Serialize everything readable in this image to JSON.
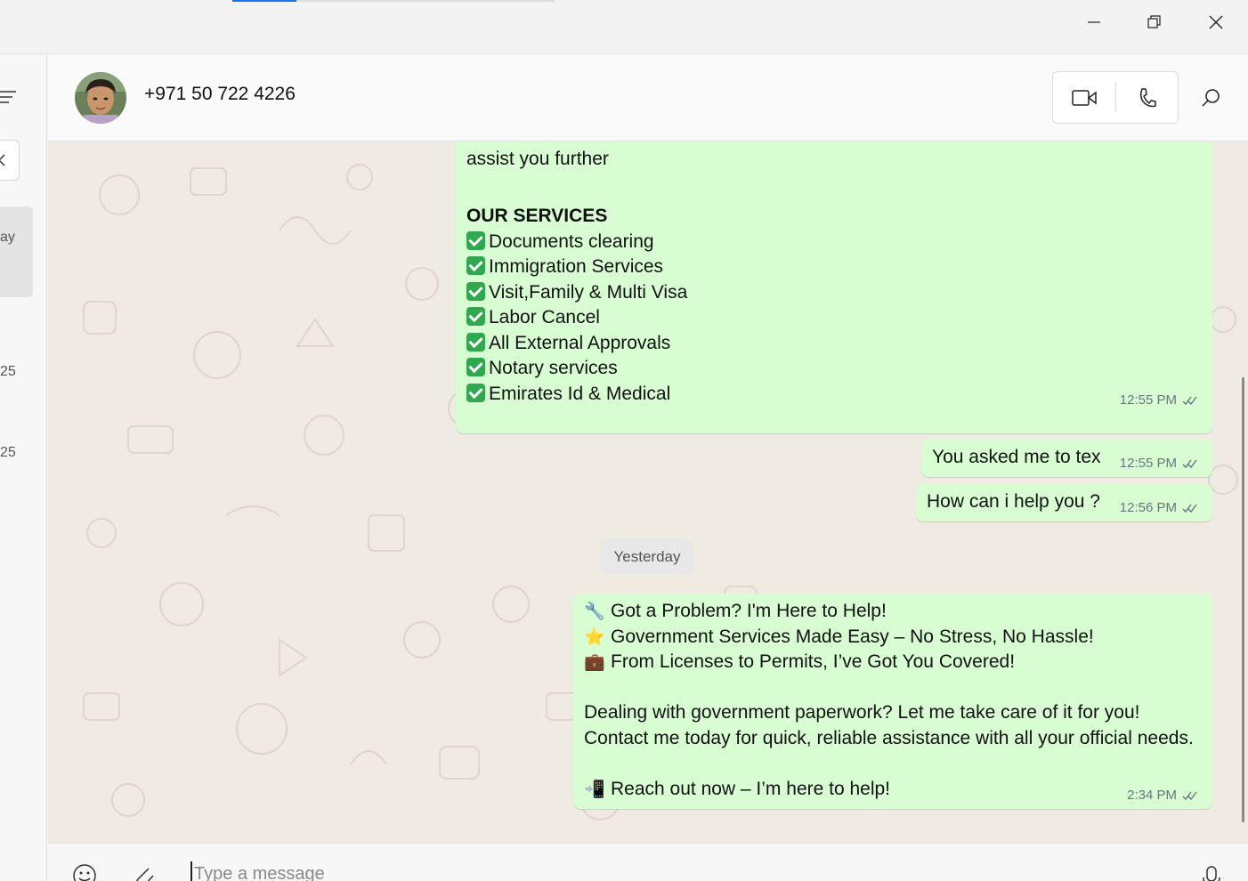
{
  "window": {
    "loading_progress": 0.2,
    "controls": [
      "minimize-icon",
      "restore-icon",
      "close-icon"
    ]
  },
  "sidebar": {
    "partial_texts": [
      "ay",
      "25",
      "25"
    ]
  },
  "header": {
    "contact_name": "+971 50 722 4226",
    "icons": [
      "video-call-icon",
      "voice-call-icon",
      "search-icon"
    ]
  },
  "messages": [
    {
      "lines": [
        "assist you further",
        "",
        "",
        "OUR SERVICES"
      ],
      "services": [
        "Documents clearing",
        "Immigration Services",
        "Visit,Family & Multi Visa",
        "Labor Cancel",
        "All External Approvals",
        "Notary services",
        "Emirates Id & Medical"
      ],
      "time": "12:55 PM"
    },
    {
      "text": "You asked me to tex",
      "time": "12:55 PM"
    },
    {
      "text": "How can i help you ?",
      "time": "12:56 PM"
    }
  ],
  "day_separator": "Yesterday",
  "last_message": {
    "lines": [
      {
        "emoji": "🔧",
        "text": "Got a Problem? I'm Here to Help!"
      },
      {
        "emoji": "⭐",
        "text": "Government Services Made Easy – No Stress, No Hassle!"
      },
      {
        "emoji": "💼",
        "text": "From Licenses to Permits, I’ve Got You Covered!"
      },
      {
        "emoji": "",
        "text": ""
      },
      {
        "emoji": "",
        "text": "Dealing with government paperwork? Let me take care of it for you!"
      },
      {
        "emoji": "",
        "text": "Contact me today for quick, reliable assistance with all your official needs."
      },
      {
        "emoji": "",
        "text": ""
      },
      {
        "emoji": "📲",
        "text": "Reach out now – I’m here to help!"
      }
    ],
    "time": "2:34 PM"
  },
  "composer": {
    "placeholder": "Type a message",
    "icons": [
      "emoji-icon",
      "attach-icon",
      "microphone-icon"
    ]
  },
  "colors": {
    "outgoing_bubble": "#d9fdd3",
    "chat_background": "#efeae2",
    "check_green": "#2fa84f",
    "loading_bar": "#1a73e8"
  }
}
